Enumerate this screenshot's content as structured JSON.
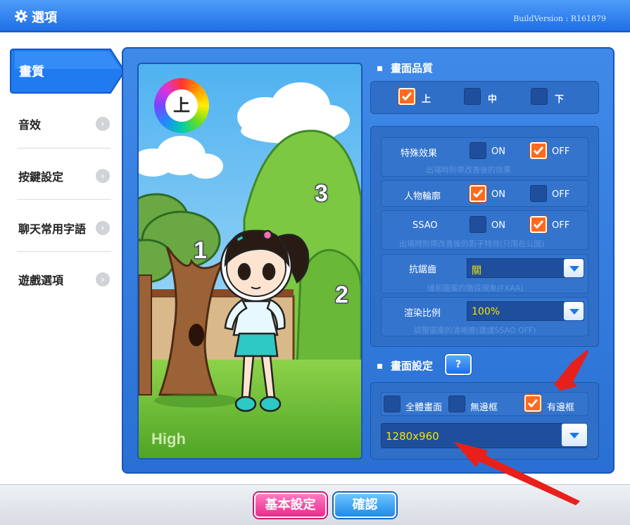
{
  "window": {
    "title": "選項",
    "build_version": "BuildVersion : R161879"
  },
  "sidebar": {
    "items": [
      {
        "label": "畫質",
        "active": true
      },
      {
        "label": "音效"
      },
      {
        "label": "按鍵設定"
      },
      {
        "label": "聊天常用字語"
      },
      {
        "label": "遊戲選項"
      }
    ]
  },
  "preview": {
    "quality_badge": "上",
    "caption": "High",
    "labels": [
      "1",
      "2",
      "3"
    ]
  },
  "quality": {
    "section_title": "畫面品質",
    "options": [
      {
        "label": "上",
        "checked": true
      },
      {
        "label": "中",
        "checked": false
      },
      {
        "label": "下",
        "checked": false
      }
    ]
  },
  "effects": [
    {
      "label": "特殊效果",
      "on_label": "ON",
      "off_label": "OFF",
      "value": "OFF",
      "desc": "出場時附帶改善後的效果"
    },
    {
      "label": "人物輪廓",
      "on_label": "ON",
      "off_label": "OFF",
      "value": "ON",
      "desc": ""
    },
    {
      "label": "SSAO",
      "on_label": "ON",
      "off_label": "OFF",
      "value": "OFF",
      "desc": "出場時附帶改善後的影子特效(只限在公園)"
    }
  ],
  "antialias": {
    "label": "抗鋸齒",
    "value": "關",
    "desc": "緩和圖案的階段現象(FXAA)"
  },
  "render_scale": {
    "label": "渲染比例",
    "value": "100%",
    "desc": "調整圖案的清晰度(建議SSAO OFF)"
  },
  "display": {
    "section_title": "畫面設定",
    "help_label": "?",
    "modes": [
      {
        "label": "全體畫面",
        "checked": false
      },
      {
        "label": "無邊框",
        "checked": false
      },
      {
        "label": "有邊框",
        "checked": true
      }
    ],
    "resolution": "1280x960"
  },
  "footer": {
    "basic_label": "基本設定",
    "confirm_label": "確認"
  },
  "colors": {
    "accent": "#2a70d4",
    "checked": "#ff6a1e",
    "value_text": "#f5e500",
    "arrow": "#e8201c"
  }
}
